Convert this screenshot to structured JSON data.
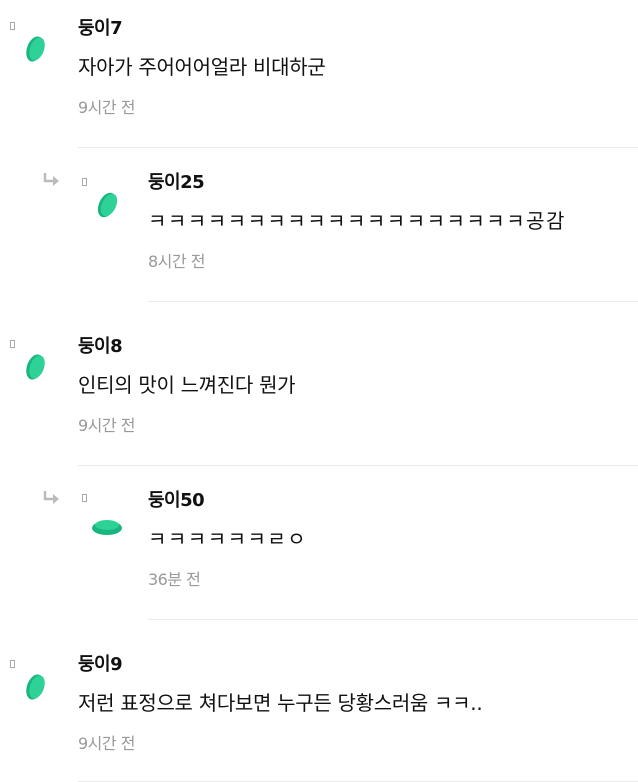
{
  "comments": [
    {
      "name": "둥이7",
      "body": "자아가 주어어어얼라 비대하군",
      "time": "9시간 전"
    },
    {
      "name": "둥이25",
      "body": "ㅋㅋㅋㅋㅋㅋㅋㅋㅋㅋㅋㅋㅋㅋㅋㅋㅋㅋㅋ공감",
      "time": "8시간 전"
    },
    {
      "name": "둥이8",
      "body": "인티의 맛이 느껴진다 뭔가",
      "time": "9시간 전"
    },
    {
      "name": "둥이50",
      "body": "ㅋㅋㅋㅋㅋㅋㄹㅇ",
      "time": "36분 전"
    },
    {
      "name": "둥이9",
      "body": "저런 표정으로 쳐다보면 누구든 당황스러움 ㅋㅋ..",
      "time": "9시간 전"
    }
  ],
  "colors": {
    "avatar_green": "#2ed196",
    "avatar_dark": "#18b57e",
    "time_gray": "#999999"
  }
}
